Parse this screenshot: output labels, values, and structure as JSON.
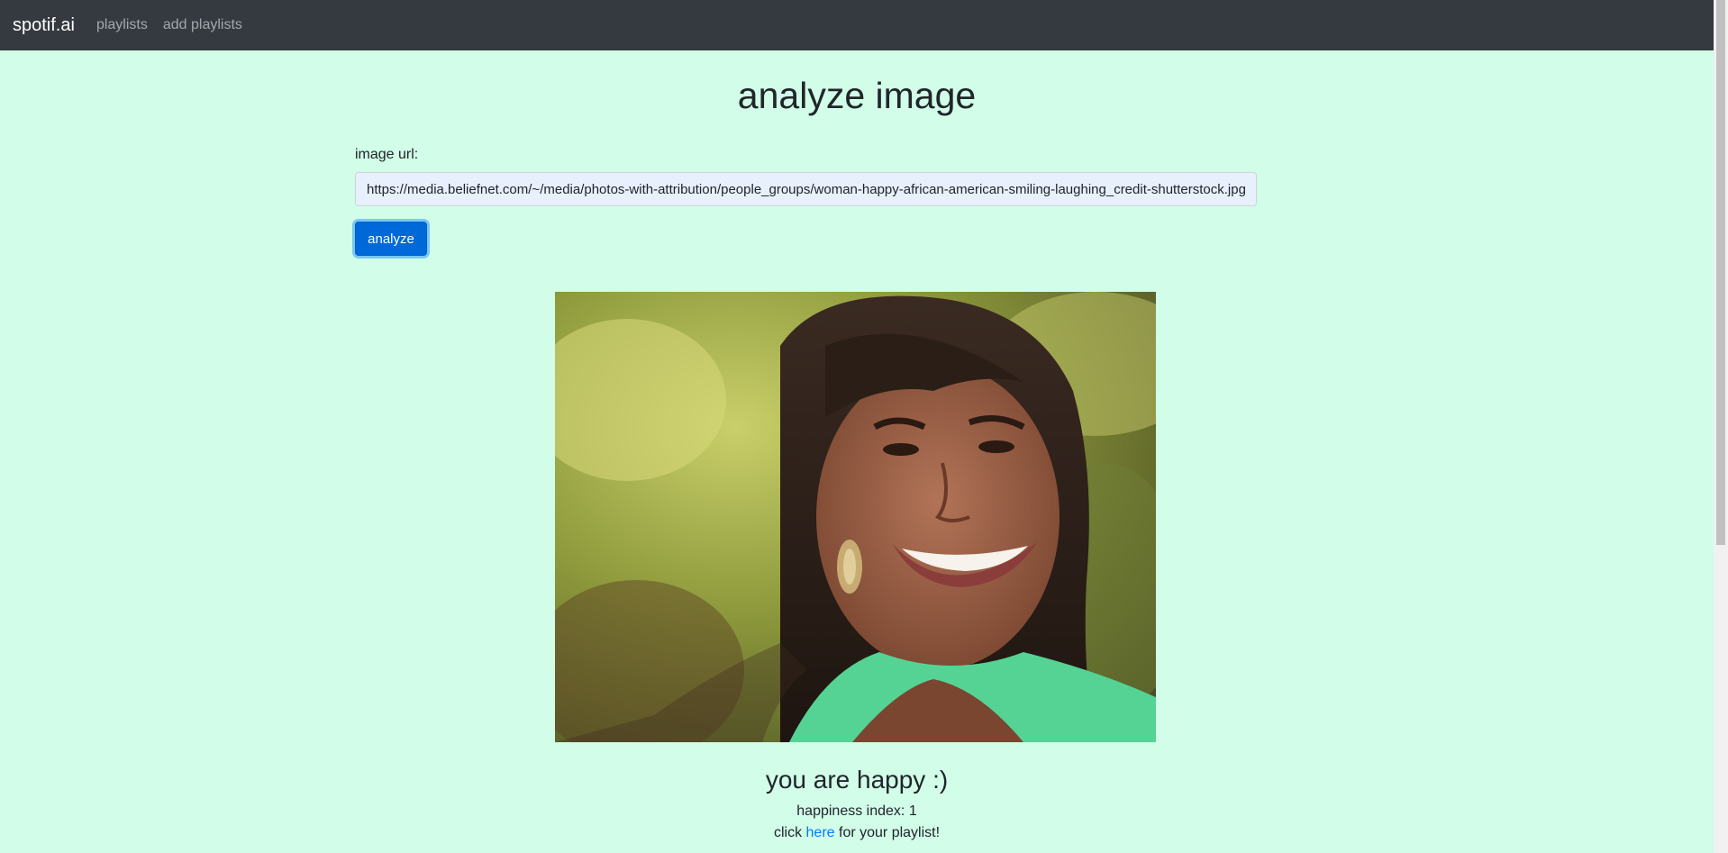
{
  "navbar": {
    "brand": "spotif.ai",
    "links": [
      "playlists",
      "add playlists"
    ]
  },
  "page": {
    "title": "analyze image"
  },
  "form": {
    "label": "image url:",
    "url_value": "https://media.beliefnet.com/~/media/photos-with-attribution/people_groups/woman-happy-african-american-smiling-laughing_credit-shutterstock.jpg",
    "button_label": "analyze"
  },
  "result": {
    "heading": "you are happy :)",
    "happiness_label": "happiness index: 1",
    "click_prefix": "click",
    "link_text": "here",
    "click_suffix": "for your playlist!"
  },
  "colors": {
    "background": "#d1fde9",
    "navbar": "#343a40",
    "button": "#0069d9",
    "link": "#007bff"
  }
}
